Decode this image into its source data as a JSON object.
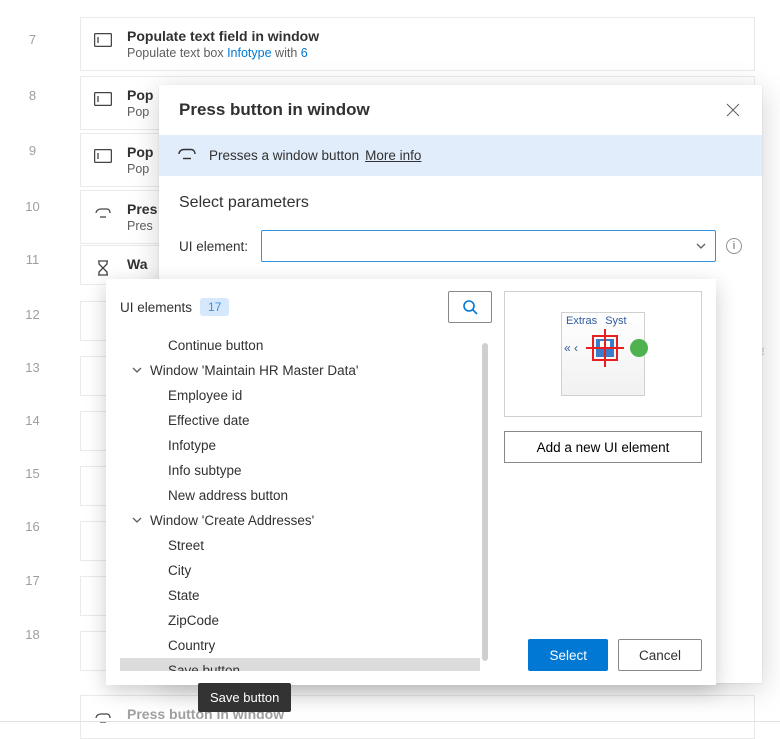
{
  "steps": {
    "nums": [
      7,
      8,
      9,
      10,
      11,
      12,
      13,
      14,
      15,
      16,
      17,
      18
    ],
    "s7": {
      "title": "Populate text field in window",
      "sub_plain": "Populate text box ",
      "link1": "Infotype",
      "mid": " with ",
      "link2": "6"
    },
    "s8": {
      "title": "Pop",
      "sub": "Pop"
    },
    "s9": {
      "title": "Pop",
      "sub": "Pop"
    },
    "s10": {
      "title": "Pres",
      "sub": "Pres"
    },
    "s11": {
      "title": "Wa"
    },
    "sLast": {
      "title": "Press button in window"
    }
  },
  "dialog": {
    "title": "Press button in window",
    "info_desc": "Presses a window button",
    "more_info": "More info",
    "section": "Select parameters",
    "param_label": "UI element:"
  },
  "dropdown": {
    "heading": "UI elements",
    "count": "17",
    "groups": {
      "g0_item": "Continue button",
      "g1": "Window 'Maintain HR Master Data'",
      "g1_items": [
        "Employee id",
        "Effective date",
        "Infotype",
        "Info subtype",
        "New address button"
      ],
      "g2": "Window 'Create Addresses'",
      "g2_items": [
        "Street",
        "City",
        "State",
        "ZipCode",
        "Country",
        "Save button"
      ]
    },
    "preview_top1": "Extras",
    "preview_top2": "Syst",
    "add_label": "Add a new UI element",
    "select": "Select",
    "cancel": "Cancel"
  },
  "tooltip": "Save button"
}
